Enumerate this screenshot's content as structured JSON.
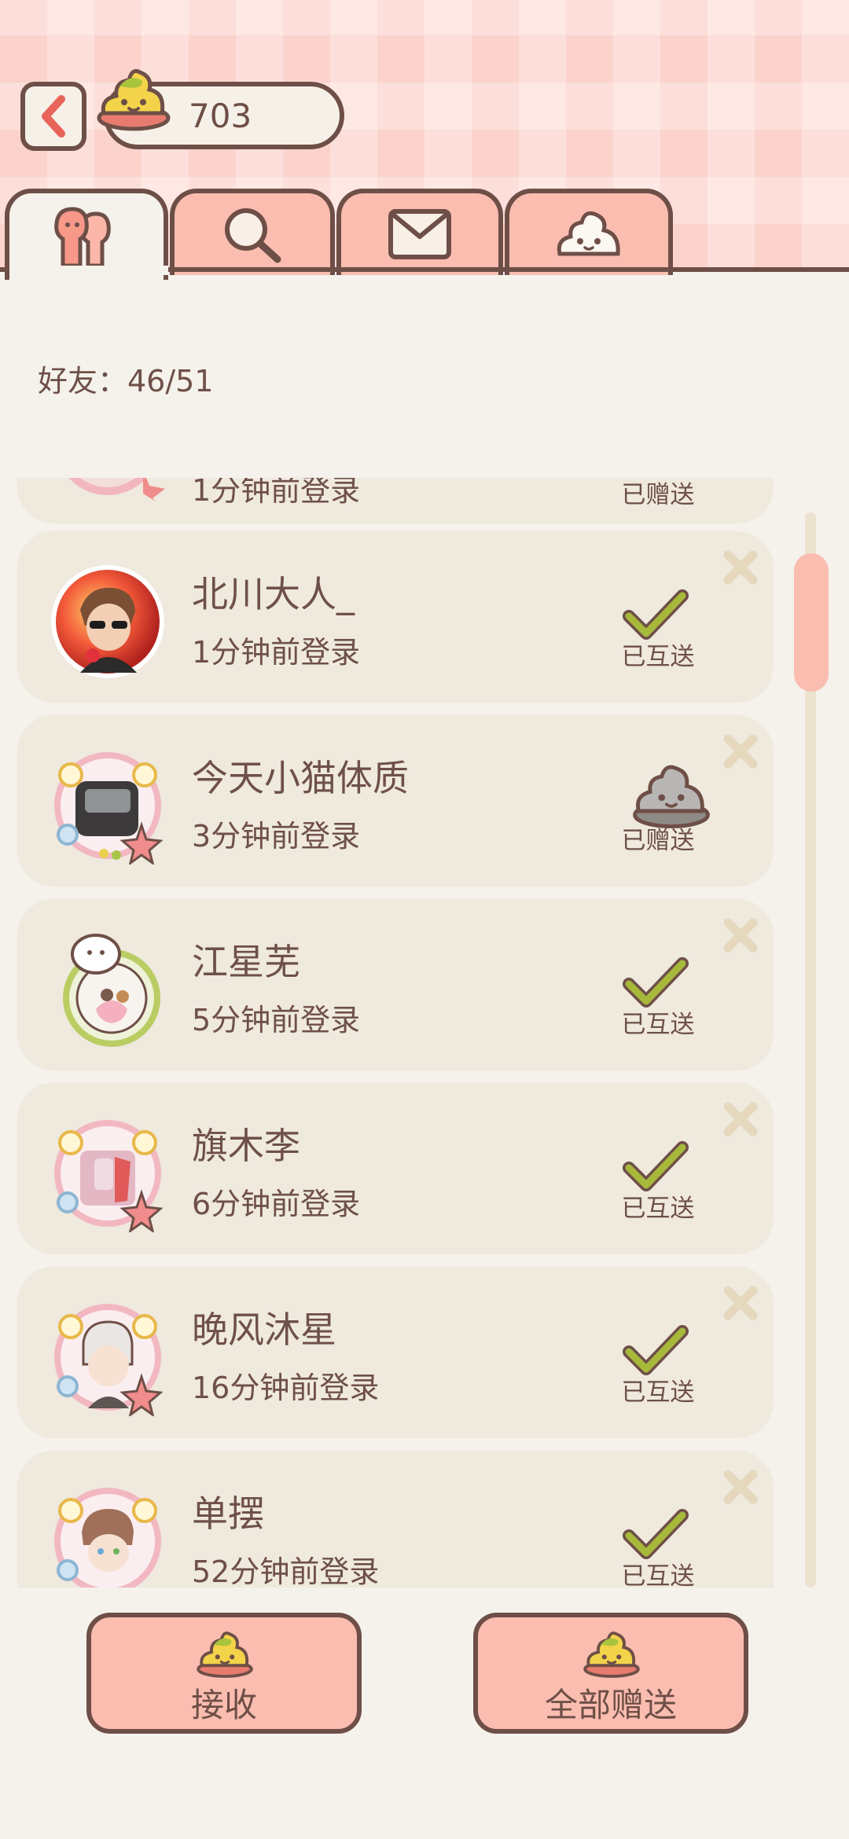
{
  "header": {
    "back_icon": "chevron-left-icon",
    "coin_icon": "poop-coin-icon",
    "coin_value": "703"
  },
  "tabs": [
    {
      "icon": "friends-icon",
      "active": true
    },
    {
      "icon": "search-icon",
      "active": false
    },
    {
      "icon": "mail-icon",
      "active": false
    },
    {
      "icon": "poop-icon",
      "active": false
    }
  ],
  "friends": {
    "count_label": "好友：46/51"
  },
  "list": {
    "partial_top": {
      "login": "1分钟前登录",
      "status": "已赠送"
    },
    "items": [
      {
        "name": "北川大人_",
        "login": "1分钟前登录",
        "status": "已互送",
        "status_icon": "check-icon"
      },
      {
        "name": "今天小猫体质",
        "login": "3分钟前登录",
        "status": "已赠送",
        "status_icon": "gray-poop-icon"
      },
      {
        "name": "江星芜",
        "login": "5分钟前登录",
        "status": "已互送",
        "status_icon": "check-icon"
      },
      {
        "name": "旗木李",
        "login": "6分钟前登录",
        "status": "已互送",
        "status_icon": "check-icon"
      },
      {
        "name": "晚风沐星",
        "login": "16分钟前登录",
        "status": "已互送",
        "status_icon": "check-icon"
      },
      {
        "name": "单摆",
        "login": "52分钟前登录",
        "status": "已互送",
        "status_icon": "check-icon"
      }
    ]
  },
  "bottom": {
    "receive_label": "接收",
    "send_all_label": "全部赠送"
  },
  "colors": {
    "outline": "#6e4f47",
    "pink": "#fbbdb0",
    "card": "#efe9de",
    "check": "#a7b93a"
  }
}
